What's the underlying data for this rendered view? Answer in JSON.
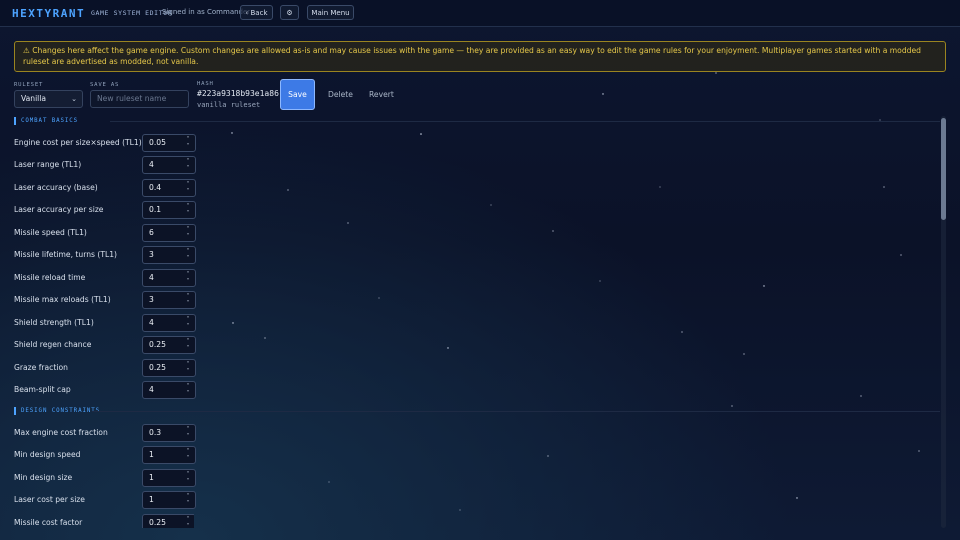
{
  "app": {
    "logo": "HEXTYRANT",
    "subtitle": "GAME SYSTEM EDITOR",
    "signed_in": "Signed in as Commander"
  },
  "toolbar": {
    "back": "‹ Back",
    "settings_icon": "⚙",
    "main_menu": "Main Menu"
  },
  "warning": {
    "text": "⚠ Changes here affect the game engine. Custom changes are allowed as-is and may cause issues with the game — they are provided as an easy way to edit the game rules for your enjoyment. Multiplayer games started with a modded ruleset are advertised as modded, not vanilla."
  },
  "controls": {
    "ruleset_label": "RULESET",
    "ruleset_value": "Vanilla",
    "saveas_label": "SAVE AS",
    "saveas_placeholder": "New ruleset name",
    "hash_label": "HASH",
    "hash_value": "#223a9318b93e1a86",
    "hash_sub": "vanilla ruleset",
    "save": "Save",
    "delete": "Delete",
    "revert": "Revert"
  },
  "sections": [
    {
      "title": "COMBAT BASICS",
      "rows": [
        {
          "label": "Engine cost per size×speed (TL1)",
          "value": "0.05"
        },
        {
          "label": "Laser range (TL1)",
          "value": "4"
        },
        {
          "label": "Laser accuracy (base)",
          "value": "0.4"
        },
        {
          "label": "Laser accuracy per size",
          "value": "0.1"
        },
        {
          "label": "Missile speed (TL1)",
          "value": "6"
        },
        {
          "label": "Missile lifetime, turns (TL1)",
          "value": "3"
        },
        {
          "label": "Missile reload time",
          "value": "4"
        },
        {
          "label": "Missile max reloads (TL1)",
          "value": "3"
        },
        {
          "label": "Shield strength (TL1)",
          "value": "4"
        },
        {
          "label": "Shield regen chance",
          "value": "0.25"
        },
        {
          "label": "Graze fraction",
          "value": "0.25"
        },
        {
          "label": "Beam-split cap",
          "value": "4"
        }
      ]
    },
    {
      "title": "DESIGN CONSTRAINTS",
      "rows": [
        {
          "label": "Max engine cost fraction",
          "value": "0.3"
        },
        {
          "label": "Min design speed",
          "value": "1"
        },
        {
          "label": "Min design size",
          "value": "1"
        },
        {
          "label": "Laser cost per size",
          "value": "1"
        },
        {
          "label": "Missile cost factor",
          "value": "0.25"
        }
      ]
    }
  ],
  "colors": {
    "accent": "#4da3ff",
    "warning": "#e6c84a",
    "save": "#3d7ae6"
  }
}
